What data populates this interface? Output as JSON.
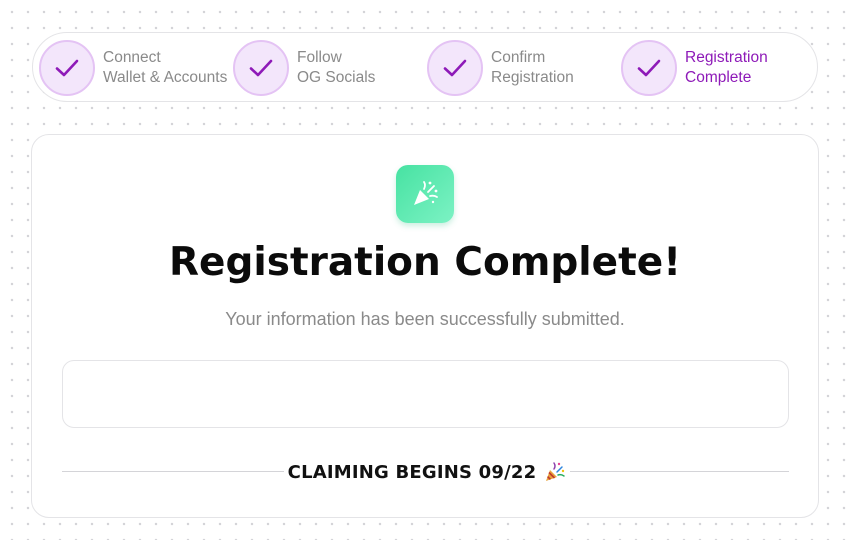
{
  "stepper": {
    "steps": [
      {
        "line1": "Connect",
        "line2": "Wallet & Accounts",
        "icon": "check-icon",
        "state": "done"
      },
      {
        "line1": "Follow",
        "line2": "OG Socials",
        "icon": "check-icon",
        "state": "done"
      },
      {
        "line1": "Confirm",
        "line2": "Registration",
        "icon": "check-icon",
        "state": "done"
      },
      {
        "line1": "Registration",
        "line2": "Complete",
        "icon": "check-icon",
        "state": "current"
      }
    ],
    "check_color": "#8e1ab8",
    "active_text_color": "#8e1ab8"
  },
  "card": {
    "icon": "party-popper-icon",
    "icon_color": "#47e2a2",
    "title": "Registration Complete!",
    "subtitle": "Your information has been successfully submitted.",
    "claim_text": "CLAIMING BEGINS 09/22",
    "claim_icon": "party-popper-icon"
  }
}
